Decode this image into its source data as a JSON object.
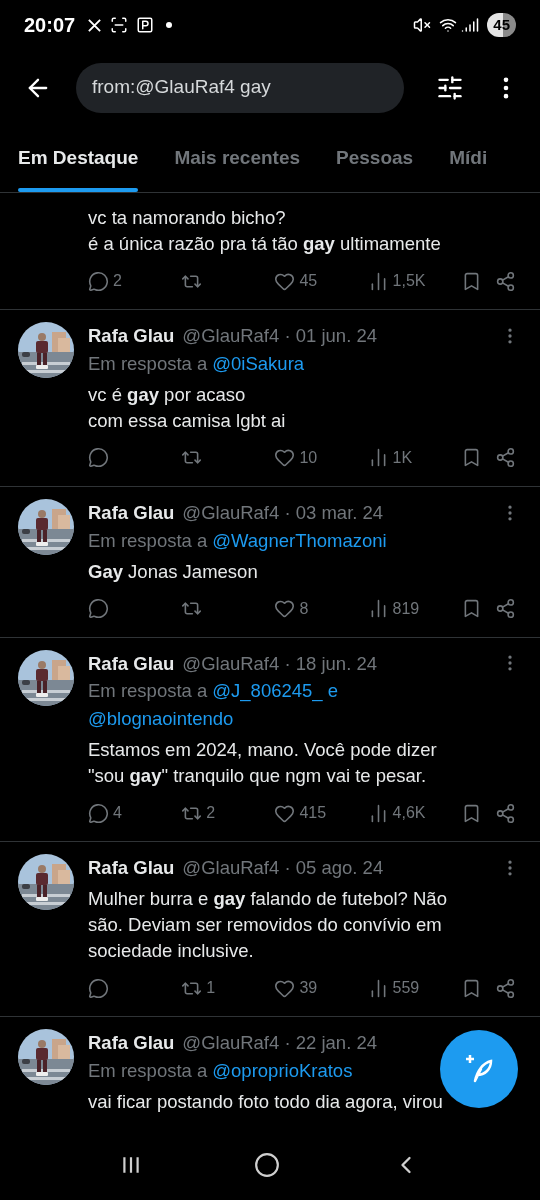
{
  "status_bar": {
    "time": "20:07",
    "battery": "45"
  },
  "search": {
    "value": "from:@GlauRaf4 gay"
  },
  "tabs": [
    {
      "label": "Em Destaque",
      "selected": true
    },
    {
      "label": "Mais recentes",
      "selected": false
    },
    {
      "label": "Pessoas",
      "selected": false
    },
    {
      "label": "Mídi",
      "selected": false
    }
  ],
  "tweets": [
    {
      "kind": "partial",
      "lines": [
        "vc ta namorando bicho?",
        "é a única razão pra tá tão **gay** ultimamente"
      ],
      "actions": {
        "replies": "2",
        "likes": "45",
        "views": "1,5K"
      }
    },
    {
      "kind": "full",
      "name": "Rafa Glau",
      "meta": "@GlauRaf4 · 01 jun. 24",
      "reply_label": "Em resposta a",
      "reply_to": [
        "@0iSakura"
      ],
      "lines": [
        "vc é **gay** por acaso",
        "com essa camisa lgbt ai"
      ],
      "actions": {
        "likes": "10",
        "views": "1K"
      }
    },
    {
      "kind": "full",
      "name": "Rafa Glau",
      "meta": "@GlauRaf4 · 03 mar. 24",
      "reply_label": "Em resposta a",
      "reply_to": [
        "@WagnerThomazoni"
      ],
      "lines": [
        "**Gay** Jonas Jameson"
      ],
      "actions": {
        "likes": "8",
        "views": "819"
      }
    },
    {
      "kind": "full",
      "name": "Rafa Glau",
      "meta": "@GlauRaf4 · 18 jun. 24",
      "reply_label": "Em resposta a",
      "reply_to": [
        "@J_806245_ e",
        "@blognaointendo"
      ],
      "lines": [
        "Estamos em 2024, mano. Você pode dizer",
        "\"sou **gay**\" tranquilo que ngm vai te pesar."
      ],
      "actions": {
        "replies": "4",
        "retweets": "2",
        "likes": "415",
        "views": "4,6K"
      }
    },
    {
      "kind": "full",
      "name": "Rafa Glau",
      "meta": "@GlauRaf4 · 05 ago. 24",
      "lines": [
        "Mulher burra e **gay** falando de futebol? Não",
        "são. Deviam ser removidos do convívio em",
        "sociedade inclusive."
      ],
      "actions": {
        "retweets": "1",
        "likes": "39",
        "views": "559"
      }
    },
    {
      "kind": "cut",
      "name": "Rafa Glau",
      "meta": "@GlauRaf4 · 22 jan. 24",
      "reply_label": "Em resposta a",
      "reply_to": [
        "@oproprioKratos"
      ],
      "lines": [
        "vai ficar postando foto todo dia agora, virou"
      ]
    }
  ]
}
